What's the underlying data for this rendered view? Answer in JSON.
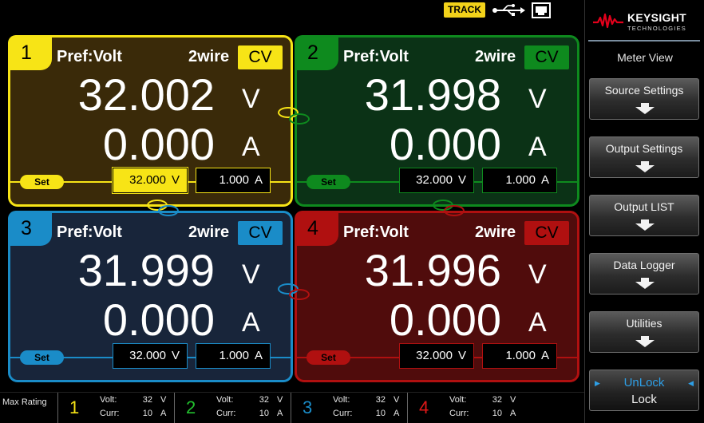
{
  "status": {
    "track_label": "TRACK",
    "usb_icon": "usb-icon",
    "lan_icon": "lan-icon"
  },
  "channels": [
    {
      "number": "1",
      "pref": "Pref:Volt",
      "wire": "2wire",
      "mode": "CV",
      "voltage": "32.002",
      "volt_unit": "V",
      "current": "0.000",
      "curr_unit": "A",
      "set_label": "Set",
      "set_voltage": "32.000",
      "set_volt_unit": "V",
      "set_current": "1.000",
      "set_curr_unit": "A",
      "color": "#f7e416"
    },
    {
      "number": "2",
      "pref": "Pref:Volt",
      "wire": "2wire",
      "mode": "CV",
      "voltage": "31.998",
      "volt_unit": "V",
      "current": "0.000",
      "curr_unit": "A",
      "set_label": "Set",
      "set_voltage": "32.000",
      "set_volt_unit": "V",
      "set_current": "1.000",
      "set_curr_unit": "A",
      "color": "#0e8a1e"
    },
    {
      "number": "3",
      "pref": "Pref:Volt",
      "wire": "2wire",
      "mode": "CV",
      "voltage": "31.999",
      "volt_unit": "V",
      "current": "0.000",
      "curr_unit": "A",
      "set_label": "Set",
      "set_voltage": "32.000",
      "set_volt_unit": "V",
      "set_current": "1.000",
      "set_curr_unit": "A",
      "color": "#1a8cc8"
    },
    {
      "number": "4",
      "pref": "Pref:Volt",
      "wire": "2wire",
      "mode": "CV",
      "voltage": "31.996",
      "volt_unit": "V",
      "current": "0.000",
      "curr_unit": "A",
      "set_label": "Set",
      "set_voltage": "32.000",
      "set_volt_unit": "V",
      "set_current": "1.000",
      "set_curr_unit": "A",
      "color": "#b01010"
    }
  ],
  "max_rating": {
    "label": "Max Rating",
    "volt_label": "Volt:",
    "curr_label": "Curr:",
    "channels": [
      {
        "number": "1",
        "volt": "32",
        "volt_unit": "V",
        "curr": "10",
        "curr_unit": "A",
        "color": "#f7e416"
      },
      {
        "number": "2",
        "volt": "32",
        "volt_unit": "V",
        "curr": "10",
        "curr_unit": "A",
        "color": "#22c12e"
      },
      {
        "number": "3",
        "volt": "32",
        "volt_unit": "V",
        "curr": "10",
        "curr_unit": "A",
        "color": "#1a8cc8"
      },
      {
        "number": "4",
        "volt": "32",
        "volt_unit": "V",
        "curr": "10",
        "curr_unit": "A",
        "color": "#e01818"
      }
    ]
  },
  "sidebar": {
    "brand_name": "KEYSIGHT",
    "brand_sub": "TECHNOLOGIES",
    "view_title": "Meter View",
    "softkeys": [
      {
        "label": "Source Settings",
        "icon": "arrow-down-icon"
      },
      {
        "label": "Output Settings",
        "icon": "arrow-down-icon"
      },
      {
        "label": "Output LIST",
        "icon": "arrow-down-icon"
      },
      {
        "label": "Data Logger",
        "icon": "arrow-down-icon"
      },
      {
        "label": "Utilities",
        "icon": "arrow-down-icon"
      }
    ],
    "lock_key": {
      "option_selected": "UnLock",
      "option_other": "Lock"
    }
  }
}
